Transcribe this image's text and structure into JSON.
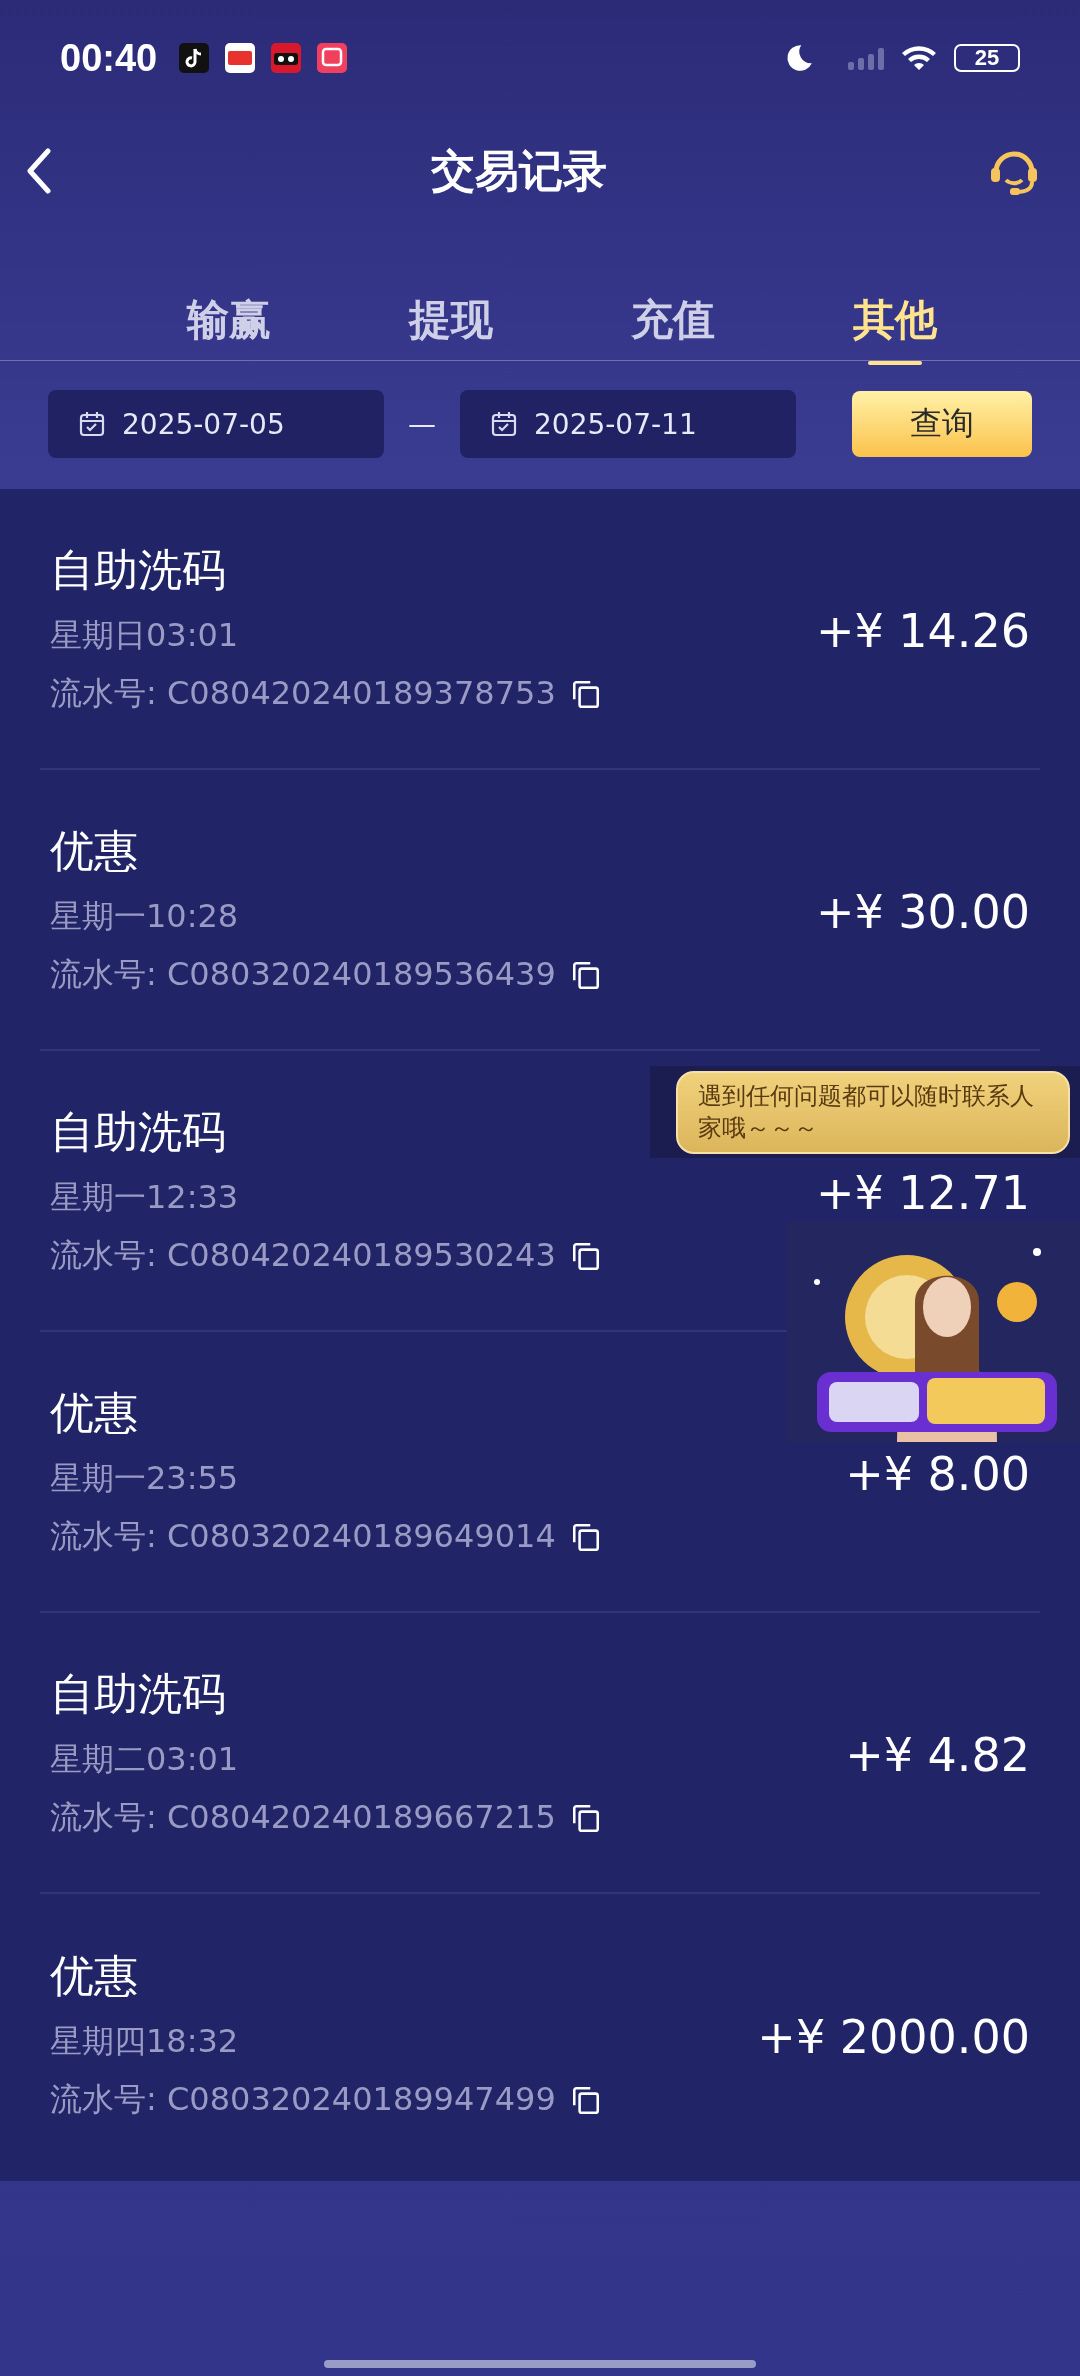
{
  "status_bar": {
    "time": "00:40",
    "battery": "25"
  },
  "header": {
    "title": "交易记录"
  },
  "tabs": [
    {
      "label": "输赢",
      "selected": false
    },
    {
      "label": "提现",
      "selected": false
    },
    {
      "label": "充值",
      "selected": false
    },
    {
      "label": "其他",
      "selected": true
    }
  ],
  "filter": {
    "start_date": "2025-07-05",
    "separator": "—",
    "end_date": "2025-07-11",
    "button": "查询"
  },
  "records": [
    {
      "title": "自助洗码",
      "time": "星期日03:01",
      "serial_label": "流水号:",
      "serial": "C080420240189378753",
      "amount": "+¥ 14.26"
    },
    {
      "title": "优惠",
      "time": "星期一10:28",
      "serial_label": "流水号:",
      "serial": "C080320240189536439",
      "amount": "+¥ 30.00"
    },
    {
      "title": "自助洗码",
      "time": "星期一12:33",
      "serial_label": "流水号:",
      "serial": "C080420240189530243",
      "amount": "+¥ 12.71"
    },
    {
      "title": "优惠",
      "time": "星期一23:55",
      "serial_label": "流水号:",
      "serial": "C080320240189649014",
      "amount": "+¥ 8.00"
    },
    {
      "title": "自助洗码",
      "time": "星期二03:01",
      "serial_label": "流水号:",
      "serial": "C080420240189667215",
      "amount": "+¥ 4.82"
    },
    {
      "title": "优惠",
      "time": "星期四18:32",
      "serial_label": "流水号:",
      "serial": "C080320240189947499",
      "amount": "+¥ 2000.00"
    }
  ],
  "support_widget": {
    "message": "遇到任何问题都可以随时联系人家哦～～～",
    "kind": "picture"
  }
}
